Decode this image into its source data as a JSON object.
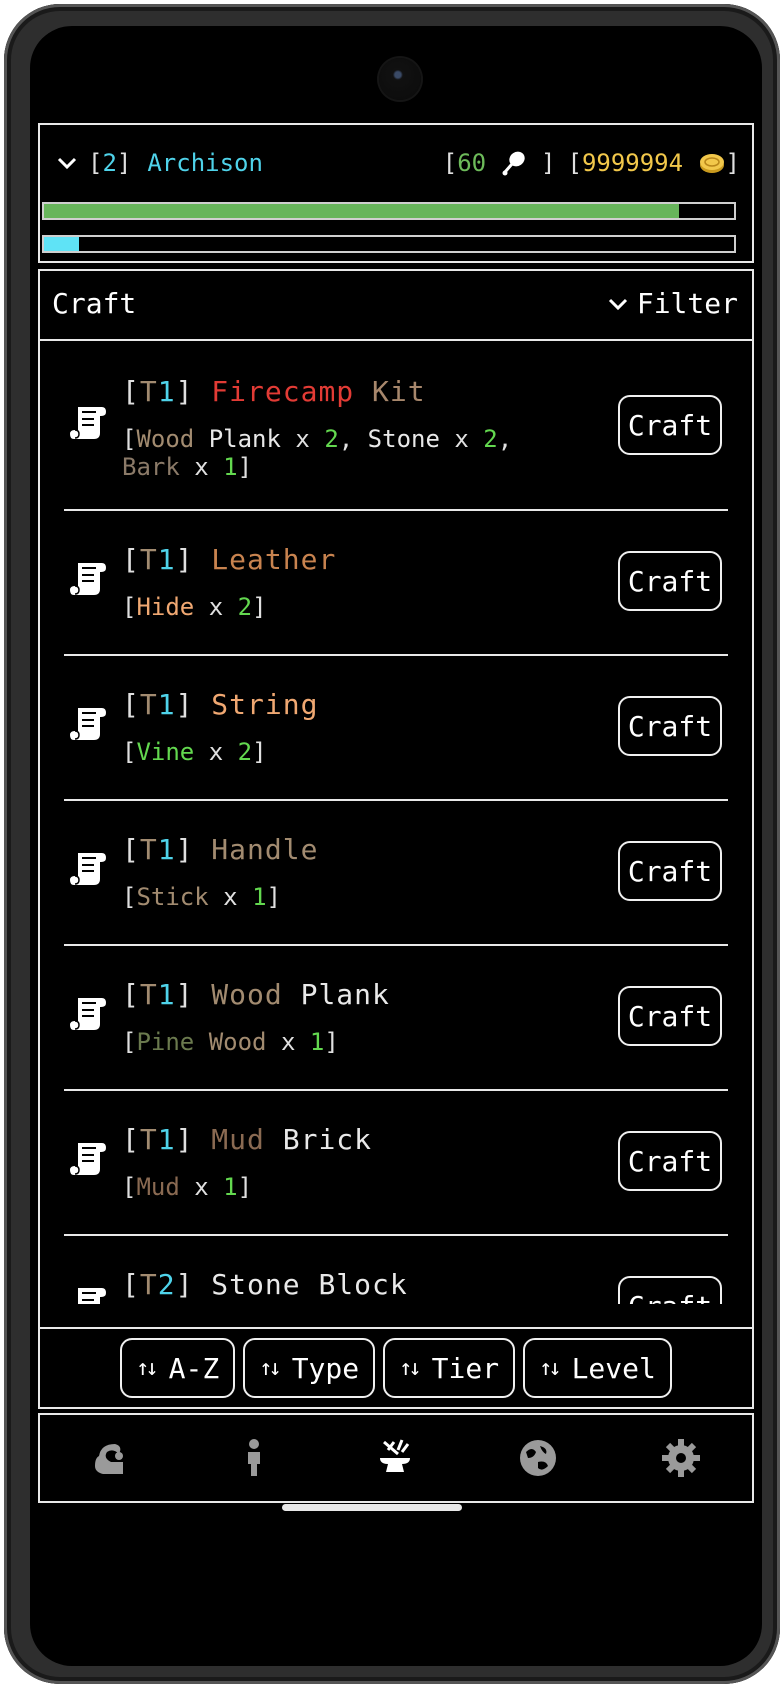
{
  "hud": {
    "level_open": "[",
    "level": "2",
    "level_close": "]",
    "player_name": "Archison",
    "food_open": "[",
    "food_count": "60",
    "food_close": "]",
    "gold_open": "[",
    "gold_count": "9999994",
    "gold_close": "]",
    "health_fraction": 0.92,
    "xp_fraction": 0.05
  },
  "panel": {
    "title": "Craft",
    "filter_label": "Filter"
  },
  "recipes": [
    {
      "tier": "1",
      "name_parts": [
        {
          "text": "Firecamp",
          "color": "#e23b35"
        },
        {
          "text": " Kit",
          "color": "#a7876c"
        }
      ],
      "req_parts": [
        {
          "text": "[",
          "color": "#e0e0e0"
        },
        {
          "text": "Wood",
          "color": "#a28b70"
        },
        {
          "text": " Plank",
          "color": "#e9e9e9"
        },
        {
          "text": " x ",
          "color": "#e0e0e0"
        },
        {
          "text": "2",
          "color": "#63d84f"
        },
        {
          "text": ", ",
          "color": "#e0e0e0"
        },
        {
          "text": "Stone",
          "color": "#e9e9e9"
        },
        {
          "text": " x ",
          "color": "#e0e0e0"
        },
        {
          "text": "2",
          "color": "#63d84f"
        },
        {
          "text": ", ",
          "color": "#e0e0e0"
        },
        {
          "text": "Bark",
          "color": "#8b7a68"
        },
        {
          "text": " x ",
          "color": "#e0e0e0"
        },
        {
          "text": "1",
          "color": "#63d84f"
        },
        {
          "text": "]",
          "color": "#e0e0e0"
        }
      ],
      "button": "Craft"
    },
    {
      "tier": "1",
      "name_parts": [
        {
          "text": "Leather",
          "color": "#c8834f"
        }
      ],
      "req_parts": [
        {
          "text": "[",
          "color": "#e0e0e0"
        },
        {
          "text": "Hide",
          "color": "#f0a872"
        },
        {
          "text": " x ",
          "color": "#e0e0e0"
        },
        {
          "text": "2",
          "color": "#63d84f"
        },
        {
          "text": "]",
          "color": "#e0e0e0"
        }
      ],
      "button": "Craft"
    },
    {
      "tier": "1",
      "name_parts": [
        {
          "text": "String",
          "color": "#f0a872"
        }
      ],
      "req_parts": [
        {
          "text": "[",
          "color": "#e0e0e0"
        },
        {
          "text": "Vine",
          "color": "#63d84f"
        },
        {
          "text": " x ",
          "color": "#e0e0e0"
        },
        {
          "text": "2",
          "color": "#63d84f"
        },
        {
          "text": "]",
          "color": "#e0e0e0"
        }
      ],
      "button": "Craft"
    },
    {
      "tier": "1",
      "name_parts": [
        {
          "text": "Handle",
          "color": "#a28b70"
        }
      ],
      "req_parts": [
        {
          "text": "[",
          "color": "#e0e0e0"
        },
        {
          "text": "Stick",
          "color": "#a28b70"
        },
        {
          "text": " x ",
          "color": "#e0e0e0"
        },
        {
          "text": "1",
          "color": "#63d84f"
        },
        {
          "text": "]",
          "color": "#e0e0e0"
        }
      ],
      "button": "Craft"
    },
    {
      "tier": "1",
      "name_parts": [
        {
          "text": "Wood",
          "color": "#a28b70"
        },
        {
          "text": " Plank",
          "color": "#e9e9e9"
        }
      ],
      "req_parts": [
        {
          "text": "[",
          "color": "#e0e0e0"
        },
        {
          "text": "Pine",
          "color": "#6b7a4e"
        },
        {
          "text": " Wood",
          "color": "#a28b70"
        },
        {
          "text": " x ",
          "color": "#e0e0e0"
        },
        {
          "text": "1",
          "color": "#63d84f"
        },
        {
          "text": "]",
          "color": "#e0e0e0"
        }
      ],
      "button": "Craft"
    },
    {
      "tier": "1",
      "name_parts": [
        {
          "text": "Mud",
          "color": "#8a6a52"
        },
        {
          "text": " Brick",
          "color": "#e9e9e9"
        }
      ],
      "req_parts": [
        {
          "text": "[",
          "color": "#e0e0e0"
        },
        {
          "text": "Mud",
          "color": "#8a6a52"
        },
        {
          "text": " x ",
          "color": "#e0e0e0"
        },
        {
          "text": "1",
          "color": "#63d84f"
        },
        {
          "text": "]",
          "color": "#e0e0e0"
        }
      ],
      "button": "Craft"
    },
    {
      "tier": "2",
      "name_parts": [
        {
          "text": "Stone Block",
          "color": "#e9e9e9"
        }
      ],
      "req_parts": [],
      "button": "Craft"
    }
  ],
  "sort_buttons": [
    "A-Z",
    "Type",
    "Tier",
    "Level"
  ],
  "nav": [
    {
      "icon": "character-stats-icon"
    },
    {
      "icon": "person-icon"
    },
    {
      "icon": "anvil-craft-icon"
    },
    {
      "icon": "world-map-icon"
    },
    {
      "icon": "settings-gear-icon"
    }
  ],
  "colors": {
    "bracket": "#e0e0e0",
    "tier_letter": "#a28b70",
    "tier_number": "#4fd3ea",
    "player_name": "#4fd3ea",
    "food": "#6dbb5a",
    "gold": "#f2c84b",
    "health": "#67b55b",
    "xp": "#5fe3f6"
  }
}
